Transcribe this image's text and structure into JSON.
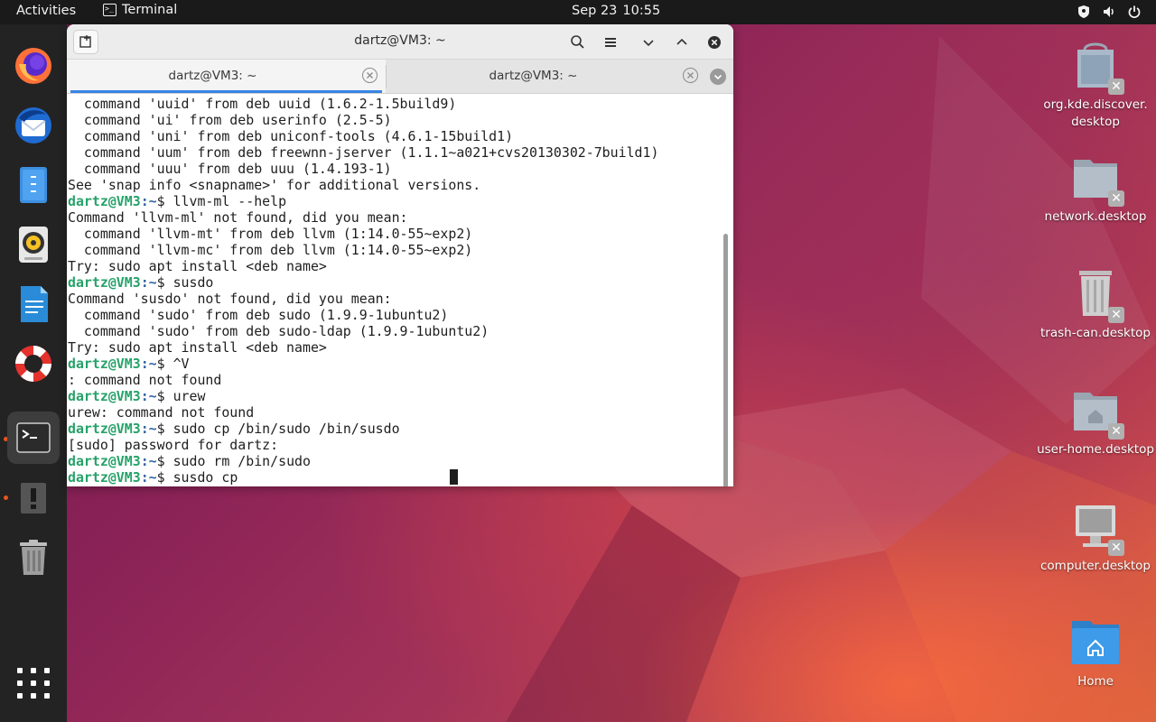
{
  "topbar": {
    "activities": "Activities",
    "app_name": "Terminal",
    "date": "Sep 23",
    "time": "10:55",
    "tray_icons": [
      "shield-icon",
      "volume-icon",
      "power-icon"
    ]
  },
  "dock": {
    "items": [
      {
        "name": "firefox",
        "icon": "firefox-icon"
      },
      {
        "name": "thunderbird",
        "icon": "thunderbird-icon"
      },
      {
        "name": "files",
        "icon": "files-icon"
      },
      {
        "name": "rhythmbox",
        "icon": "rhythmbox-icon"
      },
      {
        "name": "writer",
        "icon": "writer-icon"
      },
      {
        "name": "help",
        "icon": "help-lifebuoy-icon"
      },
      {
        "name": "terminal",
        "icon": "terminal-icon",
        "running": true,
        "active": true
      },
      {
        "name": "updates",
        "icon": "warning-icon",
        "running": true
      },
      {
        "name": "trash",
        "icon": "trash-icon"
      }
    ],
    "show_apps_icon": "grid-icon",
    "running_color": "#e95420"
  },
  "terminal": {
    "title": "dartz@VM3: ~",
    "tabs": [
      {
        "label": "dartz@VM3: ~",
        "active": true
      },
      {
        "label": "dartz@VM3: ~",
        "active": false
      }
    ],
    "prompt_user": "dartz@VM3",
    "prompt_path": ":~",
    "prompt_symbol": "$ ",
    "lines": [
      {
        "type": "out",
        "text": "  command 'uuid' from deb uuid (1.6.2-1.5build9)"
      },
      {
        "type": "out",
        "text": "  command 'ui' from deb userinfo (2.5-5)"
      },
      {
        "type": "out",
        "text": "  command 'uni' from deb uniconf-tools (4.6.1-15build1)"
      },
      {
        "type": "out",
        "text": "  command 'uum' from deb freewnn-jserver (1.1.1~a021+cvs20130302-7build1)"
      },
      {
        "type": "out",
        "text": "  command 'uuu' from deb uuu (1.4.193-1)"
      },
      {
        "type": "out",
        "text": "See 'snap info <snapname>' for additional versions."
      },
      {
        "type": "cmd",
        "text": "llvm-ml --help"
      },
      {
        "type": "out",
        "text": "Command 'llvm-ml' not found, did you mean:"
      },
      {
        "type": "out",
        "text": "  command 'llvm-mt' from deb llvm (1:14.0-55~exp2)"
      },
      {
        "type": "out",
        "text": "  command 'llvm-mc' from deb llvm (1:14.0-55~exp2)"
      },
      {
        "type": "out",
        "text": "Try: sudo apt install <deb name>"
      },
      {
        "type": "cmd",
        "text": "susdo"
      },
      {
        "type": "out",
        "text": "Command 'susdo' not found, did you mean:"
      },
      {
        "type": "out",
        "text": "  command 'sudo' from deb sudo (1.9.9-1ubuntu2)"
      },
      {
        "type": "out",
        "text": "  command 'sudo' from deb sudo-ldap (1.9.9-1ubuntu2)"
      },
      {
        "type": "out",
        "text": "Try: sudo apt install <deb name>"
      },
      {
        "type": "cmd",
        "text": "^V"
      },
      {
        "type": "out",
        "text": ": command not found"
      },
      {
        "type": "cmd",
        "text": "urew"
      },
      {
        "type": "out",
        "text": "urew: command not found"
      },
      {
        "type": "cmd",
        "text": "sudo cp /bin/sudo /bin/susdo"
      },
      {
        "type": "out",
        "text": "[sudo] password for dartz:"
      },
      {
        "type": "cmd",
        "text": "sudo rm /bin/sudo"
      },
      {
        "type": "cmd",
        "text": "susdo cp"
      }
    ],
    "colors": {
      "user": "#26a269",
      "path": "#3465a4",
      "tab_accent": "#3584e4"
    }
  },
  "desktop": {
    "icons": [
      {
        "label": "org.kde.discover.\ndesktop",
        "icon": "discover-desktop-icon"
      },
      {
        "label": "network.desktop",
        "icon": "network-desktop-icon"
      },
      {
        "label": "trash-can.desktop",
        "icon": "trash-can-desktop-icon"
      },
      {
        "label": "user-home.desktop",
        "icon": "user-home-desktop-icon"
      },
      {
        "label": "computer.desktop",
        "icon": "computer-desktop-icon"
      },
      {
        "label": "Home",
        "icon": "home-folder-icon"
      }
    ]
  }
}
